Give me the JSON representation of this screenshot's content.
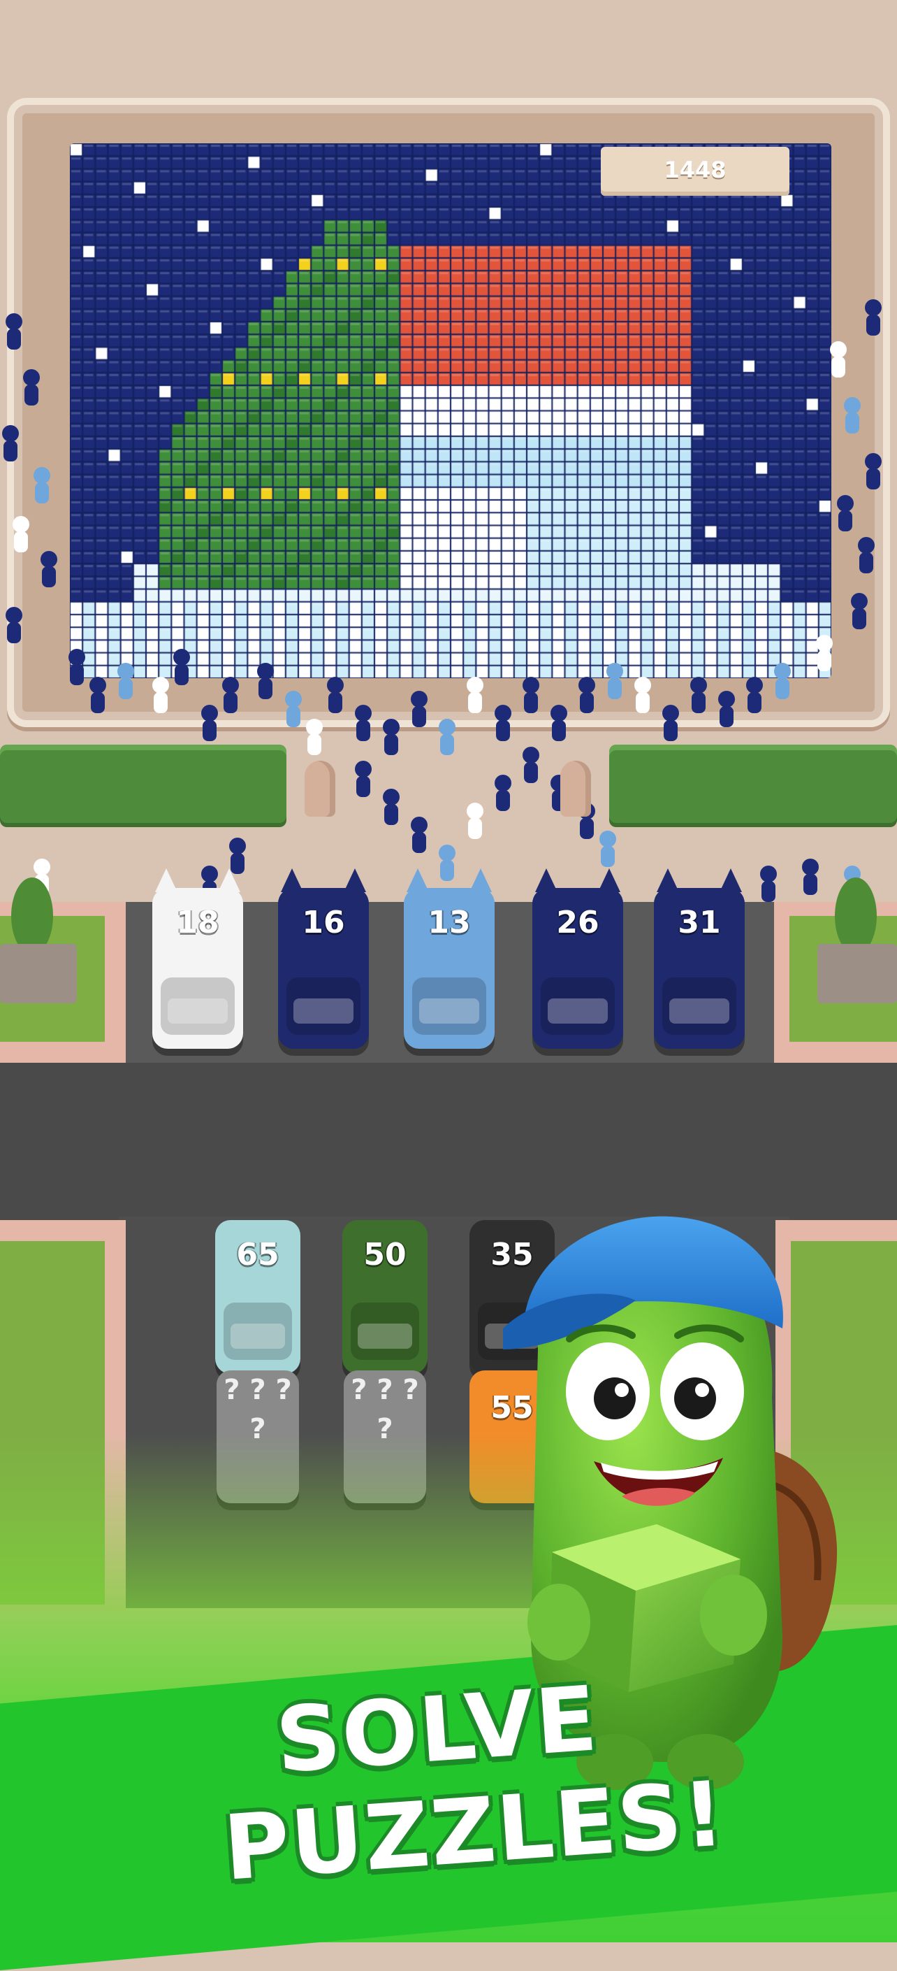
{
  "scene": {
    "mosaic_counter": "1448"
  },
  "parked_trucks": [
    {
      "count": "18",
      "color": "#f4f4f4",
      "text_color": "#333333"
    },
    {
      "count": "16",
      "color": "#1f2a6e"
    },
    {
      "count": "13",
      "color": "#6fa6dc"
    },
    {
      "count": "26",
      "color": "#1f2a6e"
    },
    {
      "count": "31",
      "color": "#1f2a6e"
    }
  ],
  "queue_trucks": [
    {
      "count": "65",
      "color": "#a7d6d8"
    },
    {
      "count": "50",
      "color": "#3f6f2c"
    },
    {
      "count": "35",
      "color": "#2f2f2f"
    },
    {
      "count": "55",
      "color": "#f28c2a"
    }
  ],
  "mystery_label": "? ? ? ?",
  "headline": {
    "line1": "SOLVE",
    "line2": "PUZZLES!"
  },
  "colors": {
    "mosaic_navy": "#1d2a78",
    "tree_green": "#3f8f3a",
    "scarf_red": "#e2553a",
    "snow_light": "#cfeefa",
    "brand_green": "#22c62c"
  }
}
